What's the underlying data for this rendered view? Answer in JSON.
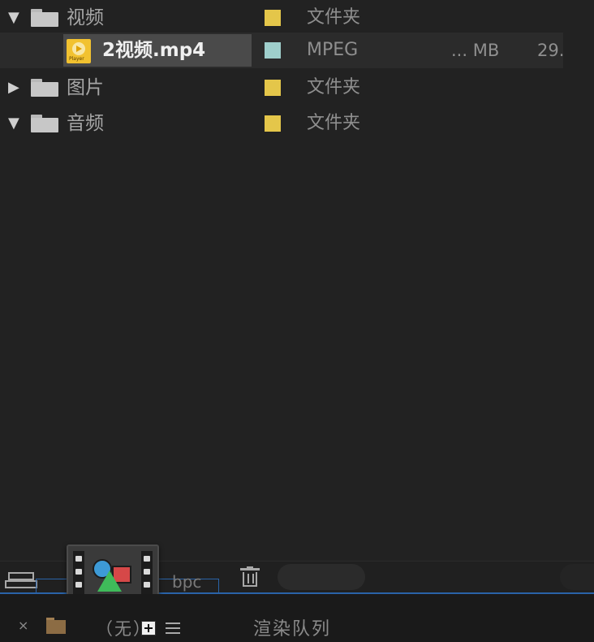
{
  "project_items": [
    {
      "twirl": "▼",
      "name": "视频",
      "label_color": "#e4c64a",
      "type": "文件夹",
      "size": "",
      "extra": ""
    },
    {
      "twirl": "",
      "name": "2视频.mp4",
      "label_color": "#9fcfcc",
      "type": "MPEG",
      "size": "... MB",
      "extra": "29."
    },
    {
      "twirl": "▶",
      "name": "图片",
      "label_color": "#e4c64a",
      "type": "文件夹",
      "size": "",
      "extra": ""
    },
    {
      "twirl": "▼",
      "name": "音频",
      "label_color": "#e4c64a",
      "type": "文件夹",
      "size": "",
      "extra": ""
    }
  ],
  "bottom_toolbar": {
    "bpc_label": "bpc"
  },
  "tabs": {
    "close_label": "×",
    "none_label": "（无）",
    "render_queue_label": "渲染队列"
  }
}
